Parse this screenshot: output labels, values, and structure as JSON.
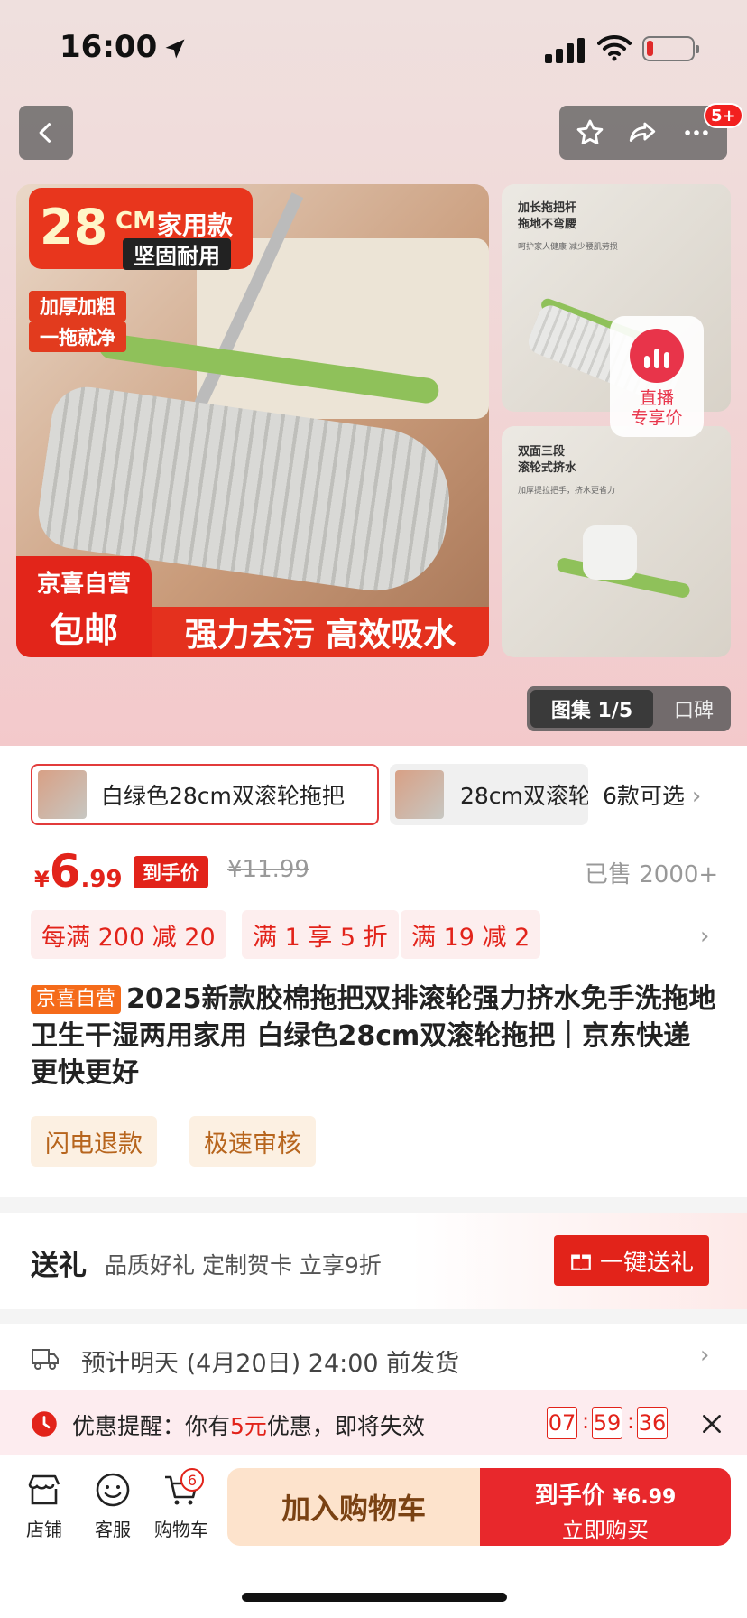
{
  "status": {
    "time": "16:00"
  },
  "header": {
    "back_icon": "chevron-left-icon",
    "cart_count": "5+"
  },
  "gallery": {
    "tag_size": "28",
    "tag_unit": "CM",
    "tag_type": "家用款",
    "tag_durable": "坚固耐用",
    "check1": "加厚加粗",
    "check2": "一拖就净",
    "badge_line1": "京喜自营",
    "badge_line2": "包邮",
    "slogan": "强力去污 高效吸水",
    "side1_title_a": "加长拖把杆",
    "side1_title_b": "拖地不弯腰",
    "side1_sub": "呵护家人健康 减少腰肌劳损",
    "side2_title_a": "双面三段",
    "side2_title_b": "滚轮式挤水",
    "side2_sub": "加厚提拉把手，挤水更省力",
    "live_line1": "直播",
    "live_line2": "专享价",
    "counter": "图集 1/5",
    "reviews": "口碑"
  },
  "variants": {
    "selected": "白绿色28cm双滚轮拖把",
    "second": "28cm双滚轮",
    "more": "6款可选"
  },
  "price": {
    "symbol": "¥",
    "integer": "6",
    "decimal": ".99",
    "label": "到手价",
    "original": "¥11.99",
    "sold": "已售 2000+"
  },
  "coupons": [
    "每满 200 减 20",
    "满 1 享 5 折",
    "满 19 减 2"
  ],
  "product": {
    "store_tag": "京喜自营",
    "title": "2025新款胶棉拖把双排滚轮强力挤水免手洗拖地卫生干湿两用家用 白绿色28cm双滚轮拖把｜京东快递 更快更好"
  },
  "service_tags": [
    "闪电退款",
    "极速审核"
  ],
  "gift": {
    "heading": "送礼",
    "desc": "品质好礼 定制贺卡 立享9折",
    "button": "一键送礼"
  },
  "shipping": {
    "text": "预计明天 (4月20日) 24:00 前发货"
  },
  "reminder": {
    "prefix": "优惠提醒：你有",
    "amount": "5元",
    "suffix": "优惠，即将失效",
    "hh": "07",
    "mm": "59",
    "ss": "36"
  },
  "bottom_nav": {
    "store": "店铺",
    "service": "客服",
    "cart": "购物车",
    "cart_badge": "6",
    "add_cart": "加入购物车",
    "buy_label": "到手价",
    "buy_price": "¥6.99",
    "buy_now": "立即购买"
  },
  "colors": {
    "accent": "#e2231a",
    "jx_orange": "#f56b1a",
    "green": "#8fc15a"
  }
}
